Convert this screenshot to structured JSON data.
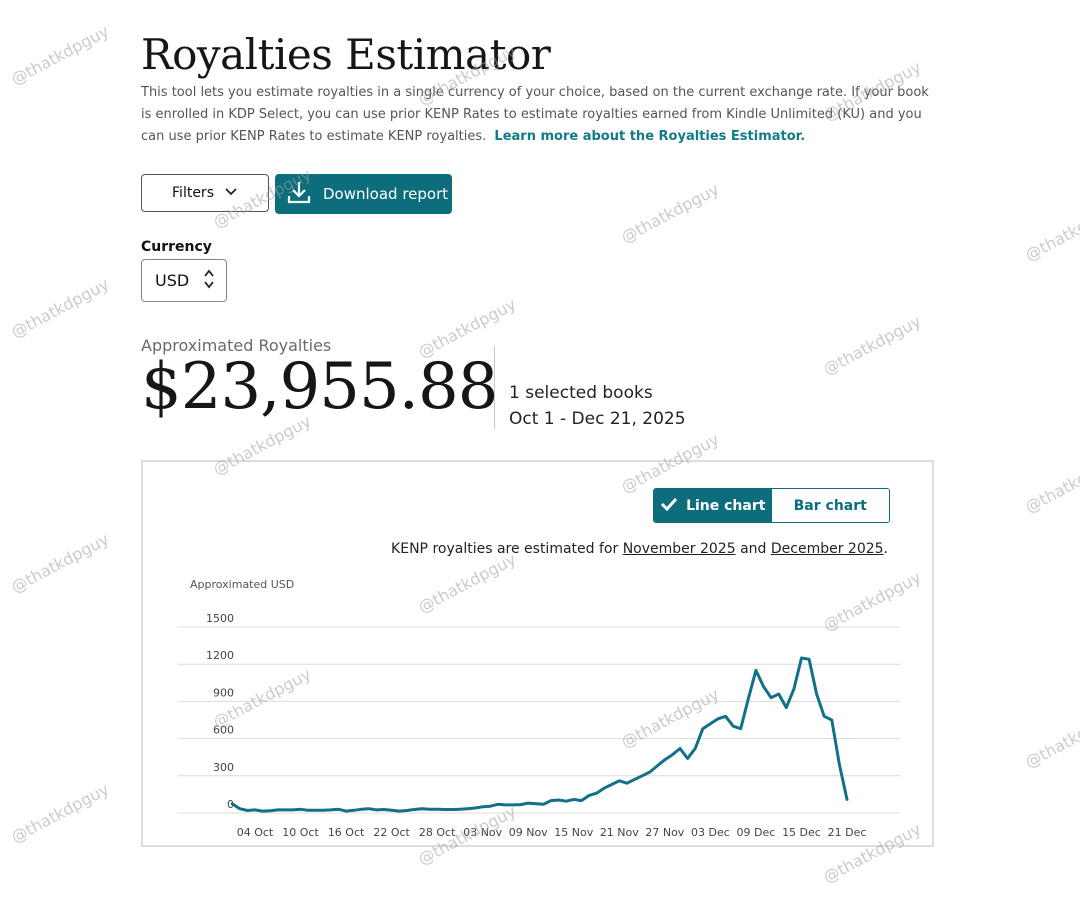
{
  "page": {
    "title": "Royalties Estimator",
    "intro": "This tool lets you estimate royalties in a single currency of your choice, based on the current exchange rate. If your book is enrolled in KDP Select, you can use prior KENP Rates to estimate royalties earned from Kindle Unlimited (KU) and you can use prior KENP Rates to estimate KENP royalties.",
    "learn_more": "Learn more about the Royalties Estimator."
  },
  "toolbar": {
    "filters_label": "Filters",
    "download_label": "Download report"
  },
  "currency": {
    "label": "Currency",
    "value": "USD"
  },
  "summary": {
    "label": "Approximated Royalties",
    "value": "$23,955.88",
    "books": "1 selected books",
    "date_range": "Oct 1 - Dec 21, 2025"
  },
  "chart_toggle": {
    "line_label": "Line chart",
    "bar_label": "Bar chart",
    "active": "line"
  },
  "kenp_note": {
    "prefix": "KENP royalties are estimated for",
    "month1": "November 2025",
    "conj": "and",
    "month2": "December 2025",
    "suffix": "."
  },
  "watermark": "@thatkdpguy",
  "colors": {
    "accent": "#0d6d7d",
    "line": "#127088",
    "link": "#127a89"
  },
  "chart_data": {
    "type": "line",
    "ylabel": "Approximated USD",
    "ylim": [
      0,
      1500
    ],
    "yticks": [
      0,
      300,
      600,
      900,
      1200,
      1500
    ],
    "grid": true,
    "x_tick_labels": [
      "04 Oct",
      "10 Oct",
      "16 Oct",
      "22 Oct",
      "28 Oct",
      "03 Nov",
      "09 Nov",
      "15 Nov",
      "21 Nov",
      "27 Nov",
      "03 Dec",
      "09 Dec",
      "15 Dec",
      "21 Dec"
    ],
    "x_start": "2025-10-01",
    "values": [
      75,
      35,
      20,
      25,
      15,
      18,
      25,
      25,
      25,
      30,
      22,
      22,
      22,
      25,
      30,
      15,
      22,
      30,
      35,
      25,
      28,
      22,
      15,
      20,
      28,
      35,
      30,
      30,
      28,
      28,
      30,
      35,
      40,
      50,
      55,
      70,
      65,
      65,
      68,
      80,
      75,
      70,
      100,
      105,
      95,
      110,
      100,
      140,
      160,
      200,
      230,
      260,
      240,
      270,
      300,
      330,
      380,
      430,
      470,
      520,
      440,
      520,
      680,
      720,
      760,
      780,
      700,
      680,
      920,
      1150,
      1020,
      930,
      960,
      850,
      1000,
      1250,
      1240,
      960,
      780,
      750,
      390,
      110
    ]
  }
}
